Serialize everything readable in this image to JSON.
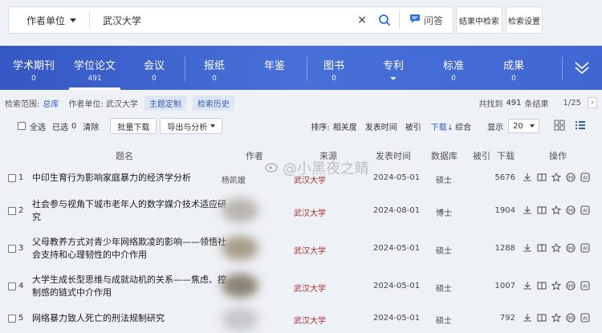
{
  "search": {
    "field": "作者单位",
    "value": "武汉大学",
    "qa_label": "问答",
    "btn_in_results": "结果中检索",
    "btn_settings": "检索设置"
  },
  "categories": [
    {
      "label": "学术期刊",
      "count": "0"
    },
    {
      "label": "学位论文",
      "count": "491"
    },
    {
      "label": "会议",
      "count": "0"
    },
    {
      "label": "报纸",
      "count": "0"
    },
    {
      "label": "年鉴",
      "count": ""
    },
    {
      "label": "图书",
      "count": "0"
    },
    {
      "label": "专利",
      "count": ""
    },
    {
      "label": "标准",
      "count": "0"
    },
    {
      "label": "成果",
      "count": "0"
    }
  ],
  "scope": {
    "label": "检索范围:",
    "db": "总库",
    "criteria": "作者单位: 武汉大学",
    "chip1": "主题定制",
    "chip2": "检索历史",
    "found_prefix": "共找到",
    "found_count": "491",
    "found_suffix": "条结果",
    "page": "1/25"
  },
  "toolbar": {
    "select_all": "全选",
    "selected": "已选",
    "selected_count": "0",
    "clear": "清除",
    "batch_download": "批量下载",
    "export": "导出与分析",
    "sort_label": "排序:",
    "sort_options": [
      "相关度",
      "发表时间",
      "被引",
      "下载",
      "综合"
    ],
    "display_label": "显示",
    "display_value": "20"
  },
  "table": {
    "headers": [
      "题名",
      "作者",
      "来源",
      "发表时间",
      "数据库",
      "被引",
      "下载",
      "操作"
    ],
    "rows": [
      {
        "num": "1",
        "title": "中印生育行为影响家庭暴力的经济学分析",
        "author": "杨凯媛",
        "source": "武汉大学",
        "date": "2024-05-01",
        "db": "硕士",
        "downloads": "5676"
      },
      {
        "num": "2",
        "title": "社会参与视角下城市老年人的数字媒介技术适应研究",
        "author": "",
        "source": "武汉大学",
        "date": "2024-08-01",
        "db": "博士",
        "downloads": "1904"
      },
      {
        "num": "3",
        "title": "父母教养方式对青少年网络欺凌的影响——领悟社会支持和心理韧性的中介作用",
        "author": "",
        "source": "武汉大学",
        "date": "2024-05-01",
        "db": "硕士",
        "downloads": "1288"
      },
      {
        "num": "4",
        "title": "大学生成长型思维与成就动机的关系——焦虑、控制感的链式中介作用",
        "author": "",
        "source": "武汉大学",
        "date": "2024-05-01",
        "db": "硕士",
        "downloads": "1007"
      },
      {
        "num": "5",
        "title": "网络暴力致人死亡的刑法规制研究",
        "author": "",
        "source": "武汉大学",
        "date": "2024-05-01",
        "db": "硕士",
        "downloads": "792"
      }
    ]
  },
  "watermark": "@小黑夜之睛",
  "colors": {
    "band": "#4268d4",
    "source": "#a4302f",
    "accent": "#2f6fd8"
  }
}
